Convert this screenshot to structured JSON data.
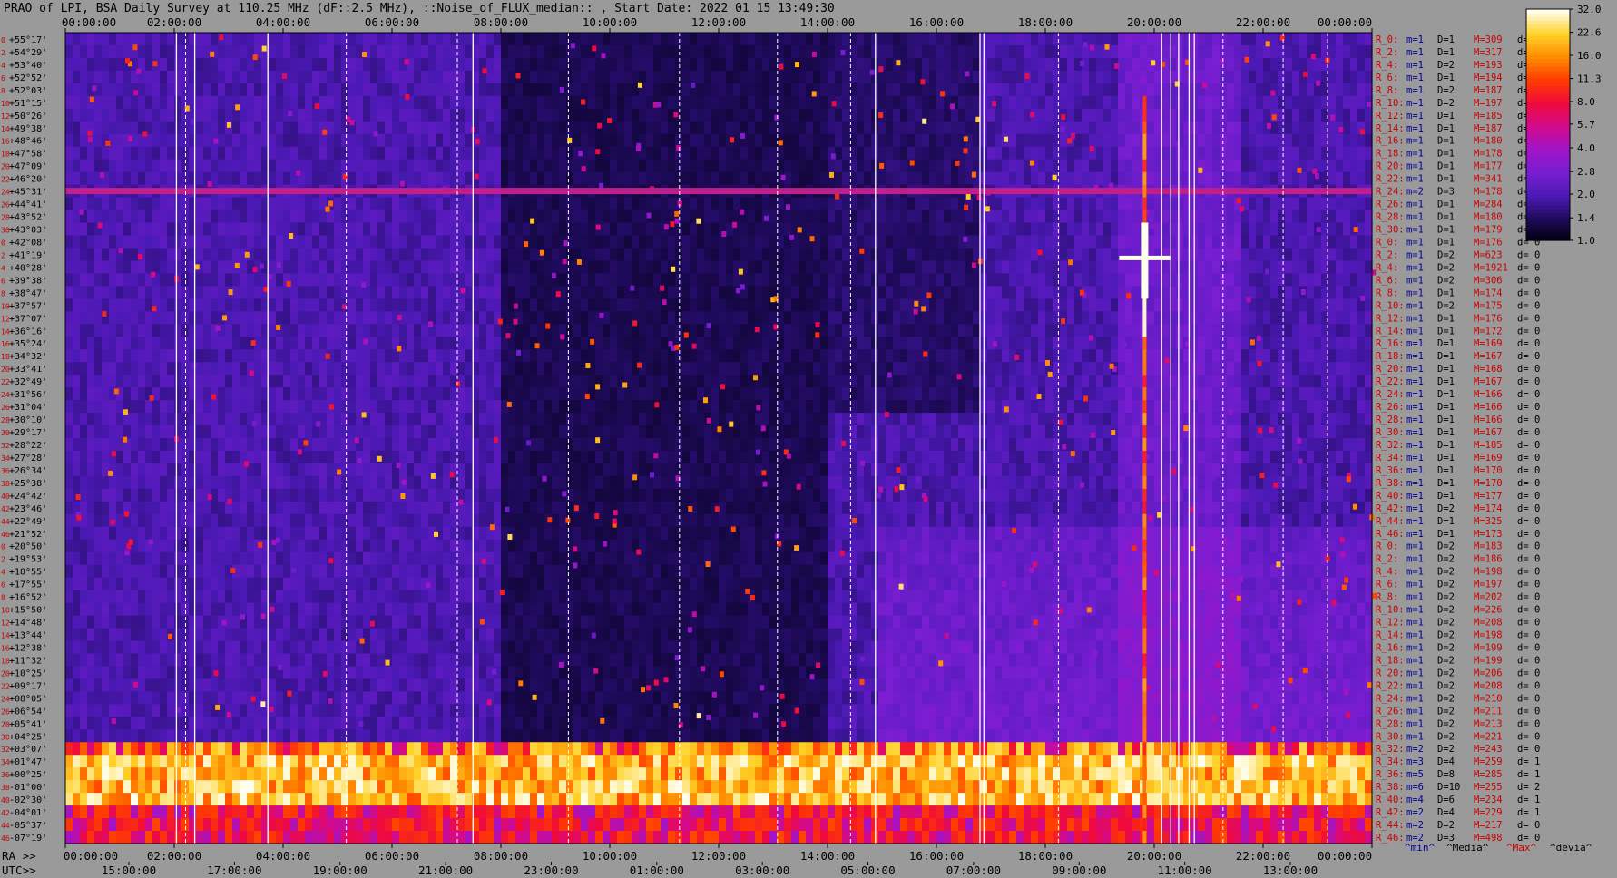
{
  "title": "PRAO of LPI, BSA Daily Survey at 110.25 MHz (dF::2.5 MHz), ::Noise_of_FLUX_median:: , Start Date: 2022 01 15 13:49:30",
  "chart_data": {
    "type": "heatmap",
    "top_axis_ticks": [
      "00:00:00",
      "02:00:00",
      "04:00:00",
      "06:00:00",
      "08:00:00",
      "10:00:00",
      "12:00:00",
      "14:00:00",
      "16:00:00",
      "18:00:00",
      "20:00:00",
      "22:00:00",
      "00:00:00"
    ],
    "ra_label": "RA >>",
    "ra_ticks": [
      "00:00:00",
      "02:00:00",
      "04:00:00",
      "06:00:00",
      "08:00:00",
      "10:00:00",
      "12:00:00",
      "14:00:00",
      "16:00:00",
      "18:00:00",
      "20:00:00",
      "22:00:00",
      "00:00:00"
    ],
    "utc_label": "UTC>>",
    "utc_ticks": [
      "15:00:00",
      "17:00:00",
      "19:00:00",
      "21:00:00",
      "23:00:00",
      "01:00:00",
      "03:00:00",
      "05:00:00",
      "07:00:00",
      "09:00:00",
      "11:00:00",
      "13:00:00"
    ],
    "dec_labels": [
      "+55°17'",
      "+54°29'",
      "+53°40'",
      "+52°52'",
      "+52°03'",
      "+51°15'",
      "+50°26'",
      "+49°38'",
      "+48°46'",
      "+47°58'",
      "+47°09'",
      "+46°20'",
      "+45°31'",
      "+44°41'",
      "+43°52'",
      "+43°03'",
      "+42°08'",
      "+41°19'",
      "+40°28'",
      "+39°38'",
      "+38°47'",
      "+37°57'",
      "+37°07'",
      "+36°16'",
      "+35°24'",
      "+34°32'",
      "+33°41'",
      "+32°49'",
      "+31°56'",
      "+31°04'",
      "+30°10'",
      "+29°17'",
      "+28°22'",
      "+27°28'",
      "+26°34'",
      "+25°38'",
      "+24°42'",
      "+23°46'",
      "+22°49'",
      "+21°52'",
      "+20°50'",
      "+19°53'",
      "+18°55'",
      "+17°55'",
      "+16°52'",
      "+15°50'",
      "+14°48'",
      "+13°44'",
      "+12°38'",
      "+11°32'",
      "+10°25'",
      "+09°17'",
      "+08°05'",
      "+06°54'",
      "+05°41'",
      "+04°25'",
      "+03°07'",
      "+01°47'",
      "+00°25'",
      "-01°00'",
      "-02°30'",
      "-04°01'",
      "-05°37'",
      "-07°19'"
    ],
    "row_indices": [
      "0",
      "2",
      "4",
      "6",
      "8",
      "10",
      "12",
      "14",
      "16",
      "18",
      "20",
      "22",
      "24",
      "26",
      "28",
      "30",
      "0",
      "2",
      "4",
      "6",
      "8",
      "10",
      "12",
      "14",
      "16",
      "18",
      "20",
      "22",
      "24",
      "26",
      "28",
      "30",
      "32",
      "34",
      "36",
      "38",
      "40",
      "42",
      "44",
      "46",
      "0",
      "2",
      "4",
      "6",
      "8",
      "10",
      "12",
      "14",
      "16",
      "18",
      "20",
      "22",
      "24",
      "26",
      "28",
      "30",
      "32",
      "34",
      "36",
      "38",
      "40",
      "42",
      "44",
      "46"
    ],
    "stats": [
      {
        "r": "R_0:",
        "m": "m=1",
        "D": "D=1",
        "M": "M=309",
        "d": "d= 0"
      },
      {
        "r": "R_2:",
        "m": "m=1",
        "D": "D=1",
        "M": "M=317",
        "d": "d= 0"
      },
      {
        "r": "R_4:",
        "m": "m=1",
        "D": "D=2",
        "M": "M=193",
        "d": "d= 0"
      },
      {
        "r": "R_6:",
        "m": "m=1",
        "D": "D=1",
        "M": "M=194",
        "d": "d= 0"
      },
      {
        "r": "R_8:",
        "m": "m=1",
        "D": "D=2",
        "M": "M=187",
        "d": "d= 0"
      },
      {
        "r": "R_10:",
        "m": "m=1",
        "D": "D=2",
        "M": "M=197",
        "d": "d="
      },
      {
        "r": "R_12:",
        "m": "m=1",
        "D": "D=1",
        "M": "M=185",
        "d": "d="
      },
      {
        "r": "R_14:",
        "m": "m=1",
        "D": "D=1",
        "M": "M=187",
        "d": "d="
      },
      {
        "r": "R_16:",
        "m": "m=1",
        "D": "D=1",
        "M": "M=180",
        "d": "d="
      },
      {
        "r": "R_18:",
        "m": "m=1",
        "D": "D=1",
        "M": "M=178",
        "d": "d="
      },
      {
        "r": "R_20:",
        "m": "m=1",
        "D": "D=1",
        "M": "M=177",
        "d": "d="
      },
      {
        "r": "R_22:",
        "m": "m=1",
        "D": "D=1",
        "M": "M=341",
        "d": "d="
      },
      {
        "r": "R_24:",
        "m": "m=2",
        "D": "D=3",
        "M": "M=178",
        "d": "d="
      },
      {
        "r": "R_26:",
        "m": "m=1",
        "D": "D=1",
        "M": "M=284",
        "d": "d="
      },
      {
        "r": "R_28:",
        "m": "m=1",
        "D": "D=1",
        "M": "M=180",
        "d": "d="
      },
      {
        "r": "R_30:",
        "m": "m=1",
        "D": "D=1",
        "M": "M=179",
        "d": "d="
      },
      {
        "r": "R_0:",
        "m": "m=1",
        "D": "D=1",
        "M": "M=176",
        "d": "d= 0"
      },
      {
        "r": "R_2:",
        "m": "m=1",
        "D": "D=2",
        "M": "M=623",
        "d": "d= 0"
      },
      {
        "r": "R_4:",
        "m": "m=1",
        "D": "D=2",
        "M": "M=1921",
        "d": "d= 0"
      },
      {
        "r": "R_6:",
        "m": "m=1",
        "D": "D=2",
        "M": "M=306",
        "d": "d= 0"
      },
      {
        "r": "R_8:",
        "m": "m=1",
        "D": "D=1",
        "M": "M=174",
        "d": "d= 0"
      },
      {
        "r": "R_10:",
        "m": "m=1",
        "D": "D=2",
        "M": "M=175",
        "d": "d= 0"
      },
      {
        "r": "R_12:",
        "m": "m=1",
        "D": "D=1",
        "M": "M=176",
        "d": "d= 0"
      },
      {
        "r": "R_14:",
        "m": "m=1",
        "D": "D=1",
        "M": "M=172",
        "d": "d= 0"
      },
      {
        "r": "R_16:",
        "m": "m=1",
        "D": "D=1",
        "M": "M=169",
        "d": "d= 0"
      },
      {
        "r": "R_18:",
        "m": "m=1",
        "D": "D=1",
        "M": "M=167",
        "d": "d= 0"
      },
      {
        "r": "R_20:",
        "m": "m=1",
        "D": "D=1",
        "M": "M=168",
        "d": "d= 0"
      },
      {
        "r": "R_22:",
        "m": "m=1",
        "D": "D=1",
        "M": "M=167",
        "d": "d= 0"
      },
      {
        "r": "R_24:",
        "m": "m=1",
        "D": "D=1",
        "M": "M=166",
        "d": "d= 0"
      },
      {
        "r": "R_26:",
        "m": "m=1",
        "D": "D=1",
        "M": "M=166",
        "d": "d= 0"
      },
      {
        "r": "R_28:",
        "m": "m=1",
        "D": "D=1",
        "M": "M=166",
        "d": "d= 0"
      },
      {
        "r": "R_30:",
        "m": "m=1",
        "D": "D=1",
        "M": "M=167",
        "d": "d= 0"
      },
      {
        "r": "R_32:",
        "m": "m=1",
        "D": "D=1",
        "M": "M=185",
        "d": "d= 0"
      },
      {
        "r": "R_34:",
        "m": "m=1",
        "D": "D=1",
        "M": "M=169",
        "d": "d= 0"
      },
      {
        "r": "R_36:",
        "m": "m=1",
        "D": "D=1",
        "M": "M=170",
        "d": "d= 0"
      },
      {
        "r": "R_38:",
        "m": "m=1",
        "D": "D=1",
        "M": "M=170",
        "d": "d= 0"
      },
      {
        "r": "R_40:",
        "m": "m=1",
        "D": "D=1",
        "M": "M=177",
        "d": "d= 0"
      },
      {
        "r": "R_42:",
        "m": "m=1",
        "D": "D=2",
        "M": "M=174",
        "d": "d= 0"
      },
      {
        "r": "R_44:",
        "m": "m=1",
        "D": "D=1",
        "M": "M=325",
        "d": "d= 0"
      },
      {
        "r": "R_46:",
        "m": "m=1",
        "D": "D=1",
        "M": "M=173",
        "d": "d= 0"
      },
      {
        "r": "R_0:",
        "m": "m=1",
        "D": "D=2",
        "M": "M=183",
        "d": "d= 0"
      },
      {
        "r": "R_2:",
        "m": "m=1",
        "D": "D=2",
        "M": "M=186",
        "d": "d= 0"
      },
      {
        "r": "R_4:",
        "m": "m=1",
        "D": "D=2",
        "M": "M=198",
        "d": "d= 0"
      },
      {
        "r": "R_6:",
        "m": "m=1",
        "D": "D=2",
        "M": "M=197",
        "d": "d= 0"
      },
      {
        "r": "R_8:",
        "m": "m=1",
        "D": "D=2",
        "M": "M=202",
        "d": "d= 0"
      },
      {
        "r": "R_10:",
        "m": "m=1",
        "D": "D=2",
        "M": "M=226",
        "d": "d= 0"
      },
      {
        "r": "R_12:",
        "m": "m=1",
        "D": "D=2",
        "M": "M=208",
        "d": "d= 0"
      },
      {
        "r": "R_14:",
        "m": "m=1",
        "D": "D=2",
        "M": "M=198",
        "d": "d= 0"
      },
      {
        "r": "R_16:",
        "m": "m=1",
        "D": "D=2",
        "M": "M=199",
        "d": "d= 0"
      },
      {
        "r": "R_18:",
        "m": "m=1",
        "D": "D=2",
        "M": "M=199",
        "d": "d= 0"
      },
      {
        "r": "R_20:",
        "m": "m=1",
        "D": "D=2",
        "M": "M=206",
        "d": "d= 0"
      },
      {
        "r": "R_22:",
        "m": "m=1",
        "D": "D=2",
        "M": "M=208",
        "d": "d= 0"
      },
      {
        "r": "R_24:",
        "m": "m=1",
        "D": "D=2",
        "M": "M=210",
        "d": "d= 0"
      },
      {
        "r": "R_26:",
        "m": "m=1",
        "D": "D=2",
        "M": "M=211",
        "d": "d= 0"
      },
      {
        "r": "R_28:",
        "m": "m=1",
        "D": "D=2",
        "M": "M=213",
        "d": "d= 0"
      },
      {
        "r": "R_30:",
        "m": "m=1",
        "D": "D=2",
        "M": "M=221",
        "d": "d= 0"
      },
      {
        "r": "R_32:",
        "m": "m=2",
        "D": "D=2",
        "M": "M=243",
        "d": "d= 0"
      },
      {
        "r": "R_34:",
        "m": "m=3",
        "D": "D=4",
        "M": "M=259",
        "d": "d= 1"
      },
      {
        "r": "R_36:",
        "m": "m=5",
        "D": "D=8",
        "M": "M=285",
        "d": "d= 1"
      },
      {
        "r": "R_38:",
        "m": "m=6",
        "D": "D=10",
        "M": "M=255",
        "d": "d= 2"
      },
      {
        "r": "R_40:",
        "m": "m=4",
        "D": "D=6",
        "M": "M=234",
        "d": "d= 1"
      },
      {
        "r": "R_42:",
        "m": "m=2",
        "D": "D=4",
        "M": "M=229",
        "d": "d= 1"
      },
      {
        "r": "R_44:",
        "m": "m=2",
        "D": "D=2",
        "M": "M=217",
        "d": "d= 0"
      },
      {
        "r": "R_46:",
        "m": "m=2",
        "D": "D=3",
        "M": "M=498",
        "d": "d= 0"
      }
    ],
    "stats_footer": {
      "min": "^min^",
      "media": "^Media^",
      "max": "^Max^",
      "devia": "^devia^"
    },
    "colorbar": {
      "ticks": [
        "32.0",
        "22.6",
        "16.0",
        "11.3",
        "8.0",
        "5.7",
        "4.0",
        "2.8",
        "2.0",
        "1.4",
        "1.0"
      ],
      "min": 1.0,
      "max": 32.0,
      "scale": "log2"
    },
    "colors": {
      "background": "#9a9a9a",
      "stat_label": "#cc0000",
      "stat_value": "#000099",
      "frame": "#000000"
    }
  }
}
